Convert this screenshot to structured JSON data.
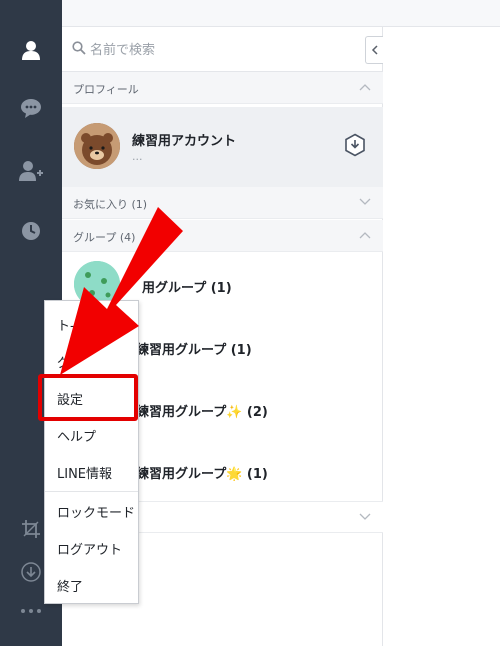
{
  "search": {
    "placeholder": "名前で検索"
  },
  "sections": {
    "profile_label": "プロフィール",
    "favorites_label": "お気に入り (1)",
    "groups_label": "グループ (4)"
  },
  "profile": {
    "name": "練習用アカウント",
    "status": "..."
  },
  "groups": [
    {
      "name": "練習用グループ (1)",
      "visible_text": "用グループ (1)"
    },
    {
      "name": "練習用グループ (1)",
      "visible_text": "練習用グループ (1)"
    },
    {
      "name": "練習用グループ✨ (2)",
      "visible_text": "練習用グループ✨ (2)"
    },
    {
      "name": "練習用グループ🌟 (1)",
      "visible_text": "練習用グループ🌟 (1)"
    }
  ],
  "menu": {
    "items": [
      "トーク",
      "グループ作成",
      "設定",
      "ヘルプ",
      "LINE情報",
      "ロックモード",
      "ログアウト",
      "終了"
    ],
    "visible_text": [
      "ト-",
      "グ",
      "設定",
      "ヘルプ",
      "LINE情報",
      "ロックモード",
      "ログアウト",
      "終了"
    ]
  },
  "colors": {
    "rail": "#2f3947",
    "highlight": "#e30000",
    "arrow": "#f00000"
  },
  "icons": {
    "rail": [
      "person-icon",
      "chat-bubble-icon",
      "add-friend-icon",
      "clock-icon",
      "crop-icon",
      "download-icon",
      "more-icon"
    ]
  }
}
